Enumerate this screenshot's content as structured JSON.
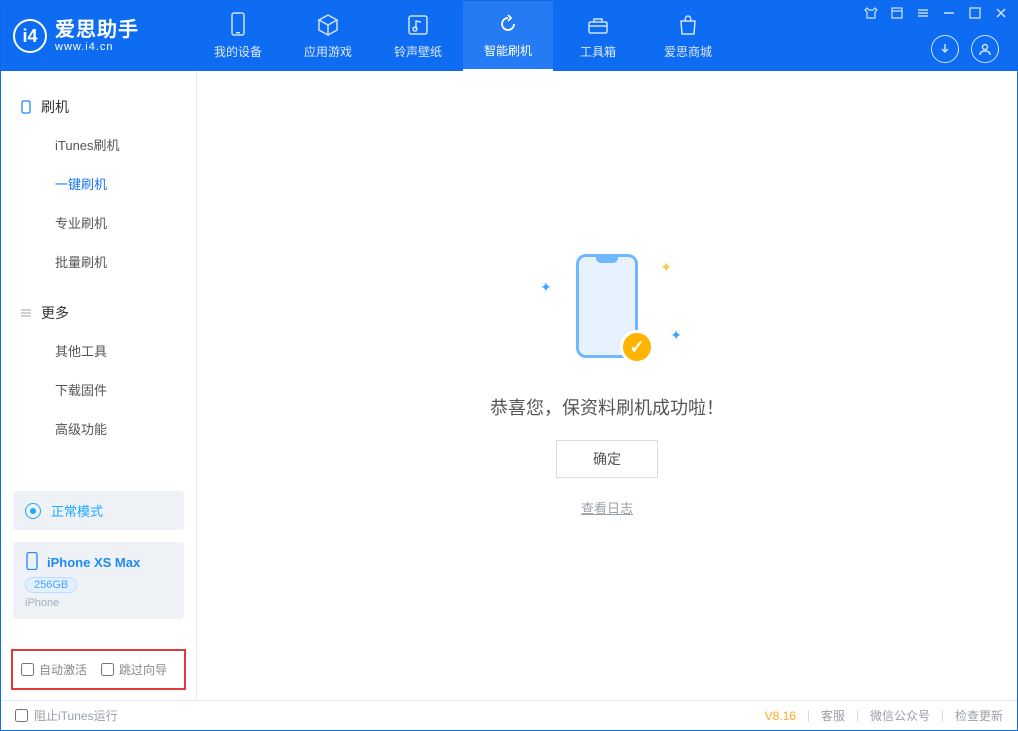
{
  "app": {
    "name": "爱思助手",
    "site": "www.i4.cn"
  },
  "nav": [
    {
      "label": "我的设备"
    },
    {
      "label": "应用游戏"
    },
    {
      "label": "铃声壁纸"
    },
    {
      "label": "智能刷机"
    },
    {
      "label": "工具箱"
    },
    {
      "label": "爱思商城"
    }
  ],
  "sidebar": {
    "group1": {
      "title": "刷机",
      "items": [
        "iTunes刷机",
        "一键刷机",
        "专业刷机",
        "批量刷机"
      ]
    },
    "group2": {
      "title": "更多",
      "items": [
        "其他工具",
        "下载固件",
        "高级功能"
      ]
    },
    "mode": "正常模式",
    "device": {
      "name": "iPhone XS Max",
      "capacity": "256GB",
      "type": "iPhone"
    },
    "opt_activate": "自动激活",
    "opt_skip": "跳过向导"
  },
  "main": {
    "message": "恭喜您，保资料刷机成功啦！",
    "ok": "确定",
    "view_log": "查看日志"
  },
  "status": {
    "block_itunes": "阻止iTunes运行",
    "version": "V8.16",
    "link1": "客服",
    "link2": "微信公众号",
    "link3": "检查更新"
  }
}
